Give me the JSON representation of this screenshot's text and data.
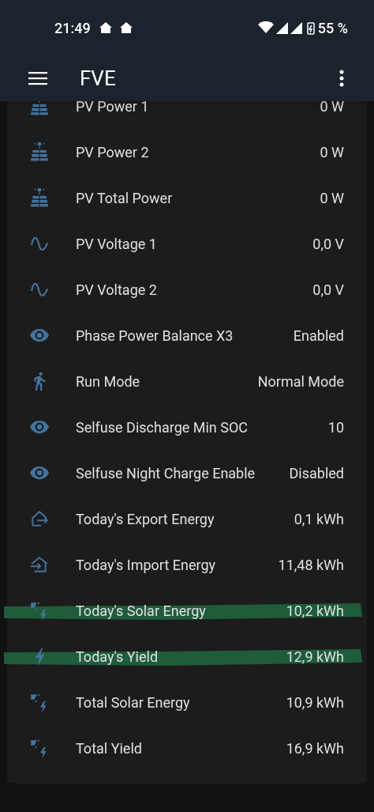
{
  "status_bar": {
    "time": "21:49",
    "battery": "55 %"
  },
  "app_bar": {
    "title": "FVE"
  },
  "rows": [
    {
      "kind": "solar",
      "name": "PV Power 1",
      "value": "0 W",
      "highlighted": false
    },
    {
      "kind": "solar",
      "name": "PV Power 2",
      "value": "0 W",
      "highlighted": false
    },
    {
      "kind": "solar",
      "name": "PV Total Power",
      "value": "0 W",
      "highlighted": false
    },
    {
      "kind": "wave",
      "name": "PV Voltage 1",
      "value": "0,0 V",
      "highlighted": false
    },
    {
      "kind": "wave",
      "name": "PV Voltage 2",
      "value": "0,0 V",
      "highlighted": false
    },
    {
      "kind": "eye",
      "name": "Phase Power Balance X3",
      "value": "Enabled",
      "highlighted": false
    },
    {
      "kind": "run",
      "name": "Run Mode",
      "value": "Normal Mode",
      "highlighted": false
    },
    {
      "kind": "eye",
      "name": "Selfuse Discharge Min SOC",
      "value": "10",
      "highlighted": false
    },
    {
      "kind": "eye",
      "name": "Selfuse Night Charge Enable",
      "value": "Disabled",
      "highlighted": false
    },
    {
      "kind": "export",
      "name": "Today's Export Energy",
      "value": "0,1 kWh",
      "highlighted": false
    },
    {
      "kind": "import",
      "name": "Today's Import Energy",
      "value": "11,48 kWh",
      "highlighted": false
    },
    {
      "kind": "solarbolt",
      "name": "Today's Solar Energy",
      "value": "10,2 kWh",
      "highlighted": true
    },
    {
      "kind": "bolt",
      "name": "Today's Yield",
      "value": "12,9 kWh",
      "highlighted": true
    },
    {
      "kind": "solarbolt",
      "name": "Total Solar Energy",
      "value": "10,9 kWh",
      "highlighted": false
    },
    {
      "kind": "solarbolt",
      "name": "Total Yield",
      "value": "16,9 kWh",
      "highlighted": false
    }
  ]
}
